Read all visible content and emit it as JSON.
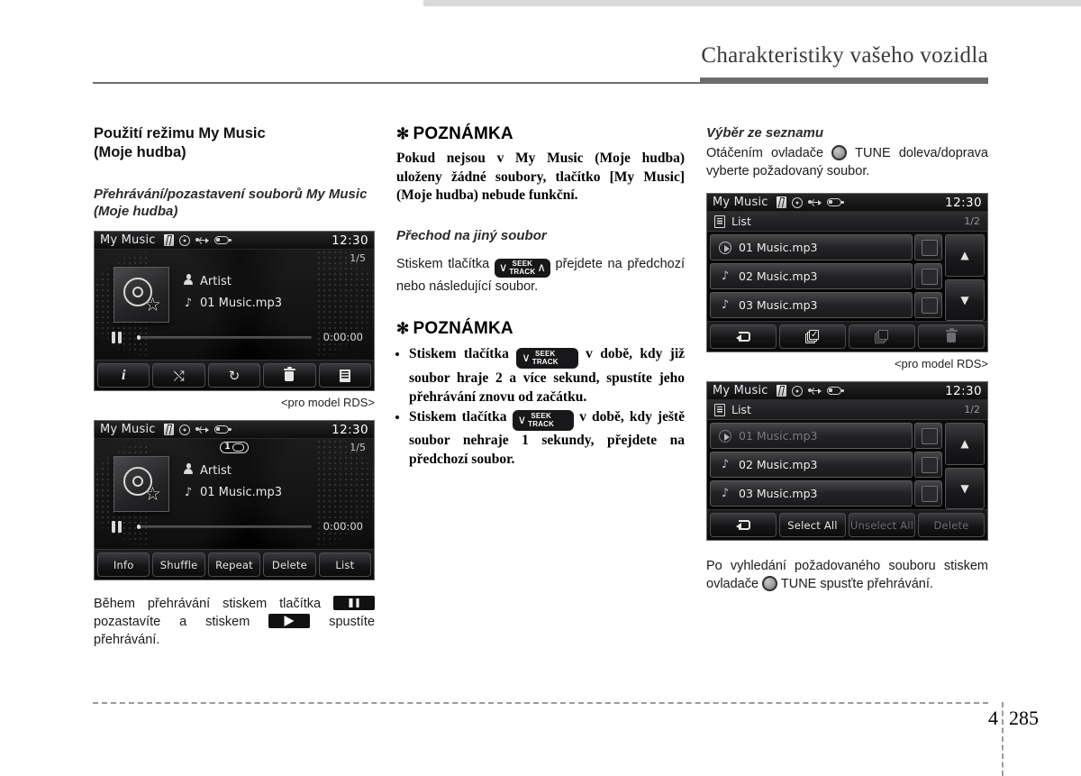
{
  "header": {
    "title": "Charakteristiky vašeho vozidla"
  },
  "footer": {
    "chapter": "4",
    "page": "285"
  },
  "left": {
    "section_title": "Použití režimu My Music\n(Moje hudba)",
    "sub_title": "Přehrávání/pozastavení souborů My Music (Moje hudba)",
    "caption_rds": "<pro model RDS>",
    "body_1": "Během přehrávání stiskem tlačítka",
    "body_2": "pozastavíte a stiskem",
    "body_3": "spustíte přehrávání."
  },
  "mid": {
    "note1_head": "POZNÁMKA",
    "note1_body": "Pokud nejsou v My Music (Moje hudba) uloženy žádné soubory, tlačítko [My Music] (Moje hudba) nebude funkční.",
    "sub_title": "Přechod na jiný soubor",
    "para_a": "Stiskem tlačítka",
    "para_b": "přejdete na předchozí nebo následující soubor.",
    "note2_head": "POZNÁMKA",
    "bullet1_a": "Stiskem tlačítka",
    "bullet1_b": "v době, kdy již soubor hraje 2 a více sekund, spustíte jeho přehrávání znovu od začátku.",
    "bullet2_a": "Stiskem tlačítka",
    "bullet2_b": "v době, kdy ještě soubor nehraje 1 sekundy, přejdete na předchozí soubor.",
    "seek_label_line1": "SEEK",
    "seek_label_line2": "TRACK",
    "chev_down": "∨",
    "chev_up": "∧",
    "asterisk": "✻"
  },
  "right": {
    "sub_title": "Výběr ze seznamu",
    "para_a": "Otáčením ovladače",
    "tune_label": "TUNE",
    "para_b": "doleva/doprava vyberte požadovaný soubor.",
    "caption_rds": "<pro model RDS>",
    "para_c": "Po vyhledání požadovaného souboru stiskem ovladače",
    "para_d": "TUNE spusťte přehrávání."
  },
  "screens": {
    "player_rds": {
      "title": "My Music",
      "clock": "12:30",
      "track_count": "1/5",
      "artist": "Artist",
      "file": "01 Music.mp3",
      "time": "0:00:00",
      "status_icons": [
        "bluetooth-icon",
        "disc-icon",
        "usb-icon",
        "battery-icon"
      ],
      "toolbar": [
        {
          "name": "info-button",
          "icon": "info-icon",
          "label": ""
        },
        {
          "name": "shuffle-button",
          "icon": "shuffle-icon",
          "label": ""
        },
        {
          "name": "repeat-button",
          "icon": "repeat-icon",
          "label": ""
        },
        {
          "name": "delete-button",
          "icon": "trash-icon",
          "label": ""
        },
        {
          "name": "list-button",
          "icon": "list-icon",
          "label": ""
        }
      ]
    },
    "player_text": {
      "title": "My Music",
      "clock": "12:30",
      "track_count": "1/5",
      "artist": "Artist",
      "file": "01 Music.mp3",
      "time": "0:00:00",
      "repeat_one": "1",
      "toolbar": [
        {
          "name": "info-button",
          "label": "Info"
        },
        {
          "name": "shuffle-button",
          "label": "Shuffle"
        },
        {
          "name": "repeat-button",
          "label": "Repeat"
        },
        {
          "name": "delete-button",
          "label": "Delete"
        },
        {
          "name": "list-button",
          "label": "List"
        }
      ]
    },
    "list_rds": {
      "title": "My Music",
      "clock": "12:30",
      "list_label": "List",
      "page": "1/2",
      "rows": [
        {
          "icon": "play-icon",
          "label": "01 Music.mp3",
          "dimmed": false
        },
        {
          "icon": "note-icon",
          "label": "02 Music.mp3",
          "dimmed": false
        },
        {
          "icon": "note-icon",
          "label": "03 Music.mp3",
          "dimmed": false
        }
      ],
      "scroll_up": "▲",
      "scroll_down": "▼",
      "toolbar": [
        {
          "name": "back-button",
          "icon": "back-arrow-icon",
          "label": "",
          "dim": false
        },
        {
          "name": "select-all-button",
          "icon": "checked-stack-icon",
          "label": "",
          "dim": false
        },
        {
          "name": "unselect-all-button",
          "icon": "blank-stack-icon",
          "label": "",
          "dim": true
        },
        {
          "name": "delete-button",
          "icon": "trash-icon",
          "label": "",
          "dim": true
        }
      ]
    },
    "list_text": {
      "title": "My Music",
      "clock": "12:30",
      "list_label": "List",
      "page": "1/2",
      "rows": [
        {
          "icon": "play-icon",
          "label": "01 Music.mp3",
          "dimmed": true
        },
        {
          "icon": "note-icon",
          "label": "02 Music.mp3",
          "dimmed": false
        },
        {
          "icon": "note-icon",
          "label": "03 Music.mp3",
          "dimmed": false
        }
      ],
      "scroll_up": "▲",
      "scroll_down": "▼",
      "toolbar": [
        {
          "name": "back-button",
          "icon": "back-arrow-icon",
          "label": "",
          "dim": false
        },
        {
          "name": "select-all-button",
          "icon": "",
          "label": "Select All",
          "dim": false
        },
        {
          "name": "unselect-all-button",
          "icon": "",
          "label": "Unselect All",
          "dim": true
        },
        {
          "name": "delete-button",
          "icon": "",
          "label": "Delete",
          "dim": true
        }
      ]
    }
  },
  "glyphs": {
    "shuffle": "⤭",
    "repeat": "↻",
    "note": "♪",
    "star": "☆",
    "info": "i"
  },
  "colors": {
    "rule": "#6d6d6d",
    "screen_bg": "#000000",
    "text": "#1a1a1a"
  }
}
